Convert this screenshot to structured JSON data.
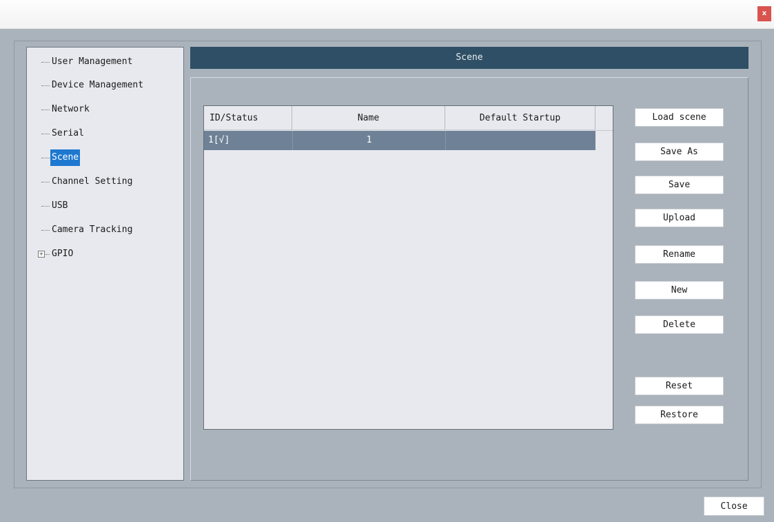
{
  "window": {
    "close_glyph": "x"
  },
  "sidebar": {
    "items": [
      {
        "label": "User Management"
      },
      {
        "label": "Device Management"
      },
      {
        "label": "Network"
      },
      {
        "label": "Serial"
      },
      {
        "label": "Scene",
        "selected": true
      },
      {
        "label": "Channel Setting"
      },
      {
        "label": "USB"
      },
      {
        "label": "Camera Tracking"
      },
      {
        "label": "GPIO",
        "expand_glyph": "+"
      }
    ]
  },
  "header": {
    "title": "Scene"
  },
  "table": {
    "columns": [
      "ID/Status",
      "Name",
      "Default Startup"
    ],
    "rows": [
      {
        "id_status": "1[√]",
        "name": "1",
        "default_startup": ""
      }
    ]
  },
  "buttons": {
    "load_scene": "Load scene",
    "save_as": "Save As",
    "save": "Save",
    "upload": "Upload",
    "rename": "Rename",
    "new": "New",
    "delete": "Delete",
    "reset": "Reset",
    "restore": "Restore"
  },
  "footer": {
    "close_label": "Close"
  },
  "colors": {
    "header_bg": "#2e4f65",
    "selection": "#1e78d0",
    "row_selected": "#6f8196",
    "close_x_bg": "#d9534f"
  }
}
